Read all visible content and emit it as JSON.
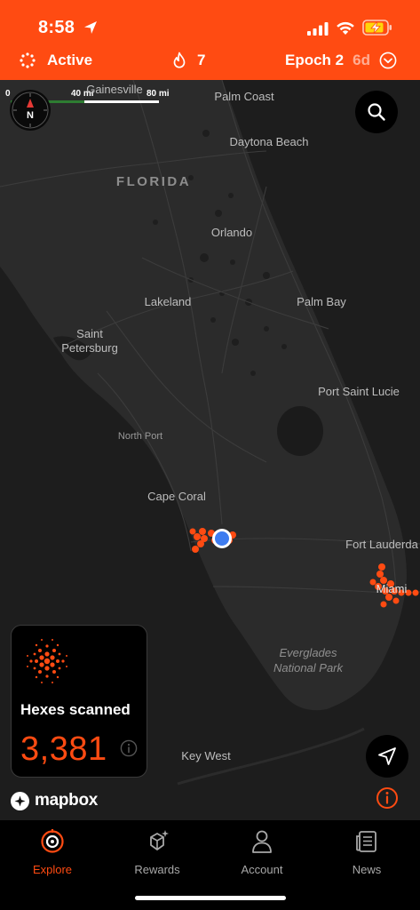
{
  "status_bar": {
    "time": "8:58",
    "icons": [
      "location-arrow-icon",
      "cellular-signal-icon",
      "wifi-icon",
      "battery-charging-icon"
    ]
  },
  "header": {
    "status_label": "Active",
    "streak_count": "7",
    "epoch_label": "Epoch 2",
    "epoch_days": "6d",
    "icons": [
      "activity-dots-icon",
      "flame-icon",
      "chevron-down-circle-icon"
    ]
  },
  "map": {
    "scale": {
      "zero": "0",
      "mid": "40 mi",
      "end": "80 mi"
    },
    "compass_label": "N",
    "state_label": "FLORIDA",
    "places": {
      "gainesville": "Gainesville",
      "palm_coast": "Palm Coast",
      "daytona_beach": "Daytona Beach",
      "orlando": "Orlando",
      "lakeland": "Lakeland",
      "palm_bay": "Palm Bay",
      "saint_petersburg_1": "Saint",
      "saint_petersburg_2": "Petersburg",
      "port_saint_lucie": "Port Saint Lucie",
      "north_port": "North Port",
      "cape_coral": "Cape Coral",
      "fort_lauderdale": "Fort Lauderda",
      "miami": "Miami",
      "everglades_1": "Everglades",
      "everglades_2": "National Park",
      "key_west": "Key West"
    },
    "attribution": "mapbox"
  },
  "hex_card": {
    "title": "Hexes scanned",
    "count": "3,381"
  },
  "tabs": [
    {
      "label": "Explore",
      "icon": "explore-target-icon",
      "active": true
    },
    {
      "label": "Rewards",
      "icon": "rewards-gem-icon",
      "active": false
    },
    {
      "label": "Account",
      "icon": "account-person-icon",
      "active": false
    },
    {
      "label": "News",
      "icon": "news-newspaper-icon",
      "active": false
    }
  ],
  "colors": {
    "accent": "#ff4b12",
    "map_background": "#202020",
    "land": "#2b2b2b",
    "user_location": "#3d7cf0"
  }
}
